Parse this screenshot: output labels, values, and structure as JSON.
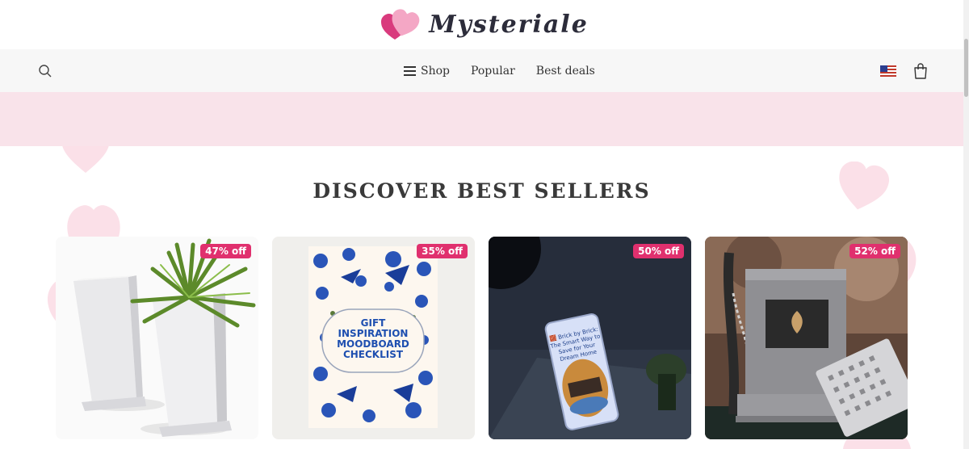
{
  "brand": {
    "name": "Mysteriale"
  },
  "nav": {
    "links": [
      {
        "label": "Shop"
      },
      {
        "label": "Popular"
      },
      {
        "label": "Best deals"
      }
    ]
  },
  "section": {
    "title": "DISCOVER BEST SELLERS"
  },
  "products": [
    {
      "discount": "47% off",
      "image": "white square planters with aloe plant"
    },
    {
      "discount": "35% off",
      "image": "blue floral notebook",
      "cover_text": [
        "GIFT",
        "INSPIRATION",
        "MOODBOARD",
        "CHECKLIST"
      ]
    },
    {
      "discount": "50% off",
      "image": "phone showing ebook",
      "cover_text": [
        "🧱 Brick by Brick:",
        "The Smart Way to",
        "Save for Your",
        "Dream Home"
      ]
    },
    {
      "discount": "52% off",
      "image": "portable stove box"
    }
  ],
  "colors": {
    "accent": "#e0306e",
    "banner": "#f9e3ea",
    "nav_bg": "#f7f7f7"
  }
}
